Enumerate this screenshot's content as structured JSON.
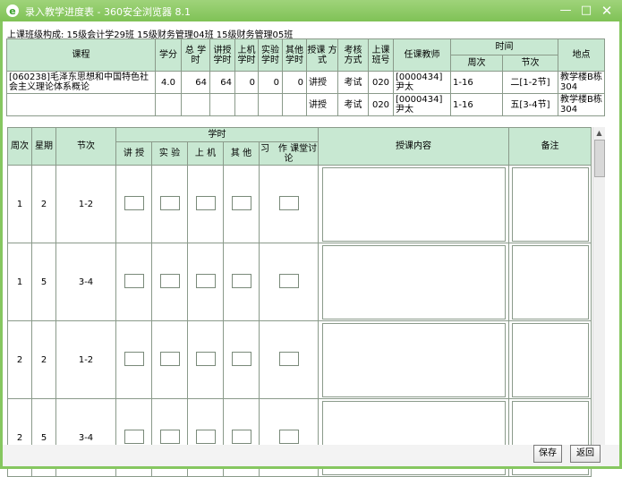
{
  "window": {
    "title": "录入教学进度表 - 360安全浏览器 8.1",
    "minimize": "—",
    "maximize": "□",
    "close": "✕"
  },
  "class_info": "上课班级构成: 15级会计学29班 15级财务管理04班 15级财务管理05班",
  "course_table": {
    "headers": {
      "course": "课程",
      "credit": "学分",
      "total": "总 学时",
      "lecture": "讲授 学时",
      "computer": "上机 学时",
      "experiment": "实验 学时",
      "other": "其他 学时",
      "teach_mode": "授课 方式",
      "exam_mode": "考核 方式",
      "class_no": "上课 班号",
      "teacher": "任课教师",
      "time": "时间",
      "week": "周次",
      "section": "节次",
      "location": "地点"
    },
    "rows": [
      {
        "course": "[060238]毛泽东思想和中国特色社会主义理论体系概论",
        "credit": "4.0",
        "total": "64",
        "lecture": "64",
        "computer": "0",
        "experiment": "0",
        "other": "0",
        "teach_mode": "讲授",
        "exam_mode": "考试",
        "class_no": "020",
        "teacher": "[0000434]尹太",
        "week": "1-16",
        "section": "二[1-2节]",
        "location": "教学楼B栋304"
      },
      {
        "course": "",
        "credit": "",
        "total": "",
        "lecture": "",
        "computer": "",
        "experiment": "",
        "other": "",
        "teach_mode": "讲授",
        "exam_mode": "考试",
        "class_no": "020",
        "teacher": "[0000434]尹太",
        "week": "1-16",
        "section": "五[3-4节]",
        "location": "教学楼B栋304"
      }
    ]
  },
  "progress_table": {
    "headers": {
      "week": "周次",
      "weekday": "星期",
      "section": "节次",
      "hours": "学时",
      "lecture": "讲 授",
      "experiment": "实 验",
      "computer": "上 机",
      "other": "其 他",
      "exercise": "习　作 课堂讨论",
      "content": "授课内容",
      "note": "备注"
    },
    "rows": [
      {
        "week": "1",
        "weekday": "2",
        "section": "1-2"
      },
      {
        "week": "1",
        "weekday": "5",
        "section": "3-4"
      },
      {
        "week": "2",
        "weekday": "2",
        "section": "1-2"
      },
      {
        "week": "2",
        "weekday": "5",
        "section": "3-4"
      }
    ]
  },
  "buttons": {
    "save": "保存",
    "back": "返回"
  },
  "icons": {
    "app": "browser-logo-icon",
    "scroll_up": "scroll-up-icon"
  }
}
